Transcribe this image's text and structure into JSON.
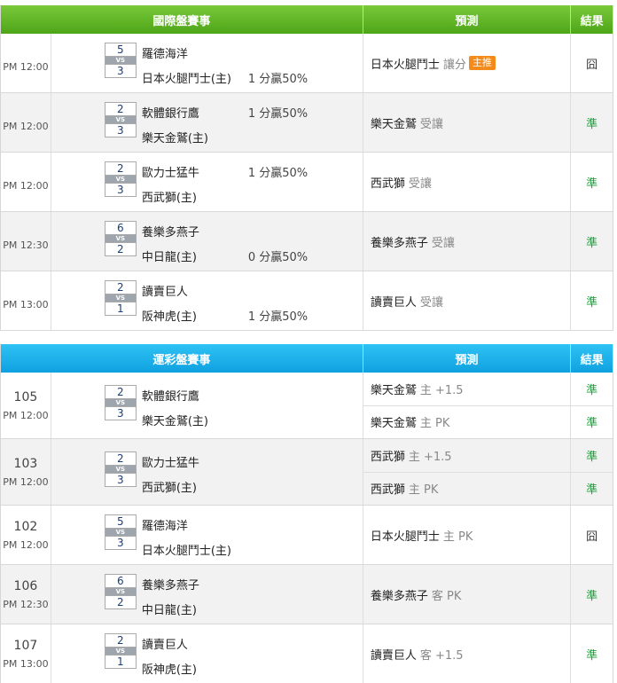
{
  "intl": {
    "header": {
      "game": "國際盤賽事",
      "pred": "預測",
      "result": "結果"
    },
    "rows": [
      {
        "time": "PM 12:00",
        "top": {
          "score": "5",
          "team": "羅德海洋"
        },
        "bottom": {
          "score": "3",
          "team": "日本火腿鬥士(主)"
        },
        "odds": "1 分贏50%",
        "odds_pos": "bottom",
        "pred_team": "日本火腿鬥士",
        "pred_note": "讓分",
        "badge": "主推",
        "result": "囧"
      },
      {
        "time": "PM 12:00",
        "top": {
          "score": "2",
          "team": "軟體銀行鷹"
        },
        "bottom": {
          "score": "3",
          "team": "樂天金鷲(主)"
        },
        "odds": "1 分贏50%",
        "odds_pos": "top",
        "pred_team": "樂天金鷲",
        "pred_note": "受讓",
        "result": "準"
      },
      {
        "time": "PM 12:00",
        "top": {
          "score": "2",
          "team": "歐力士猛牛"
        },
        "bottom": {
          "score": "3",
          "team": "西武獅(主)"
        },
        "odds": "1 分贏50%",
        "odds_pos": "top",
        "pred_team": "西武獅",
        "pred_note": "受讓",
        "result": "準"
      },
      {
        "time": "PM 12:30",
        "top": {
          "score": "6",
          "team": "養樂多燕子"
        },
        "bottom": {
          "score": "2",
          "team": "中日龍(主)"
        },
        "odds": "0 分贏50%",
        "odds_pos": "bottom",
        "pred_team": "養樂多燕子",
        "pred_note": "受讓",
        "result": "準"
      },
      {
        "time": "PM 13:00",
        "top": {
          "score": "2",
          "team": "讀賣巨人"
        },
        "bottom": {
          "score": "1",
          "team": "阪神虎(主)"
        },
        "odds": "1 分贏50%",
        "odds_pos": "bottom",
        "pred_team": "讀賣巨人",
        "pred_note": "受讓",
        "result": "準"
      }
    ]
  },
  "lottery": {
    "header": {
      "game": "運彩盤賽事",
      "pred": "預測",
      "result": "結果"
    },
    "rows": [
      {
        "id": "105",
        "time": "PM 12:00",
        "top": {
          "score": "2",
          "team": "軟體銀行鷹"
        },
        "bottom": {
          "score": "3",
          "team": "樂天金鷲(主)"
        },
        "preds": [
          {
            "team": "樂天金鷲",
            "note": "主 +1.5",
            "result": "準"
          },
          {
            "team": "樂天金鷲",
            "note": "主 PK",
            "result": "準"
          }
        ]
      },
      {
        "id": "103",
        "time": "PM 12:00",
        "top": {
          "score": "2",
          "team": "歐力士猛牛"
        },
        "bottom": {
          "score": "3",
          "team": "西武獅(主)"
        },
        "preds": [
          {
            "team": "西武獅",
            "note": "主 +1.5",
            "result": "準"
          },
          {
            "team": "西武獅",
            "note": "主 PK",
            "result": "準"
          }
        ]
      },
      {
        "id": "102",
        "time": "PM 12:00",
        "top": {
          "score": "5",
          "team": "羅德海洋"
        },
        "bottom": {
          "score": "3",
          "team": "日本火腿鬥士(主)"
        },
        "preds": [
          {
            "team": "日本火腿鬥士",
            "note": "主 PK",
            "result": "囧"
          }
        ]
      },
      {
        "id": "106",
        "time": "PM 12:30",
        "top": {
          "score": "6",
          "team": "養樂多燕子"
        },
        "bottom": {
          "score": "2",
          "team": "中日龍(主)"
        },
        "preds": [
          {
            "team": "養樂多燕子",
            "note": "客 PK",
            "result": "準"
          }
        ]
      },
      {
        "id": "107",
        "time": "PM 13:00",
        "top": {
          "score": "2",
          "team": "讀賣巨人"
        },
        "bottom": {
          "score": "1",
          "team": "阪神虎(主)"
        },
        "preds": [
          {
            "team": "讀賣巨人",
            "note": "客 +1.5",
            "result": "準"
          }
        ]
      }
    ]
  },
  "vs_label": "VS",
  "colors": {
    "green_header": "#5cb326",
    "blue_header": "#1aaeea",
    "win": "#1c9d3a",
    "badge": "#f28a1c"
  }
}
